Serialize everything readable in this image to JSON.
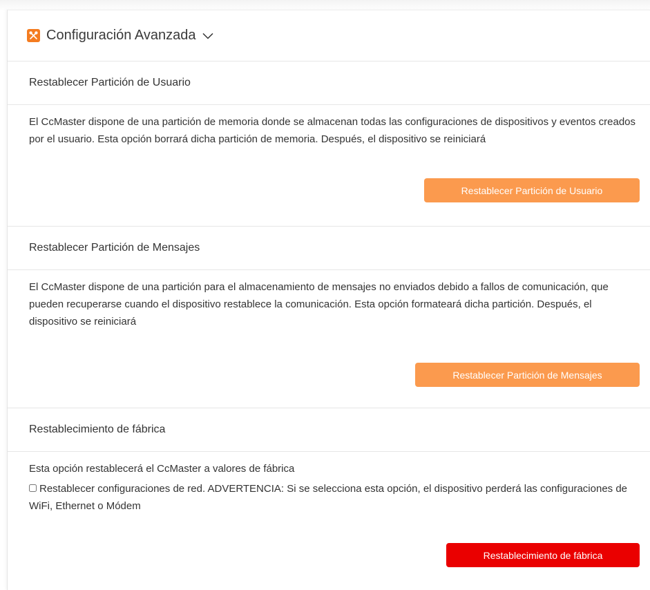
{
  "header": {
    "title": "Configuración Avanzada",
    "icon": "tools-icon",
    "accent_color": "#f47c20"
  },
  "sections": [
    {
      "title": "Restablecer Partición de Usuario",
      "description": "El CcMaster dispone de una partición de memoria donde se almacenan todas las configuraciones de dispositivos y eventos creados por el usuario. Esta opción borrará dicha partición de memoria. Después, el dispositivo se reiniciará",
      "button_label": "Restablecer Partición de Usuario",
      "button_color": "#fb9a4e"
    },
    {
      "title": "Restablecer Partición de Mensajes",
      "description": "El CcMaster dispone de una partición para el almacenamiento de mensajes no enviados debido a fallos de comunicación, que pueden recuperarse cuando el dispositivo restablece la comunicación. Esta opción formateará dicha partición. Después, el dispositivo se reiniciará",
      "button_label": "Restablecer Partición de Mensajes",
      "button_color": "#fb9a4e"
    },
    {
      "title": "Restablecimiento de fábrica",
      "description": "Esta opción restablecerá el CcMaster a valores de fábrica",
      "checkbox_label": "Restablecer configuraciones de red. ADVERTENCIA: Si se selecciona esta opción, el dispositivo perderá las configuraciones de WiFi, Ethernet o Módem",
      "checkbox_checked": false,
      "button_label": "Restablecimiento de fábrica",
      "button_color": "#ea0000"
    }
  ]
}
